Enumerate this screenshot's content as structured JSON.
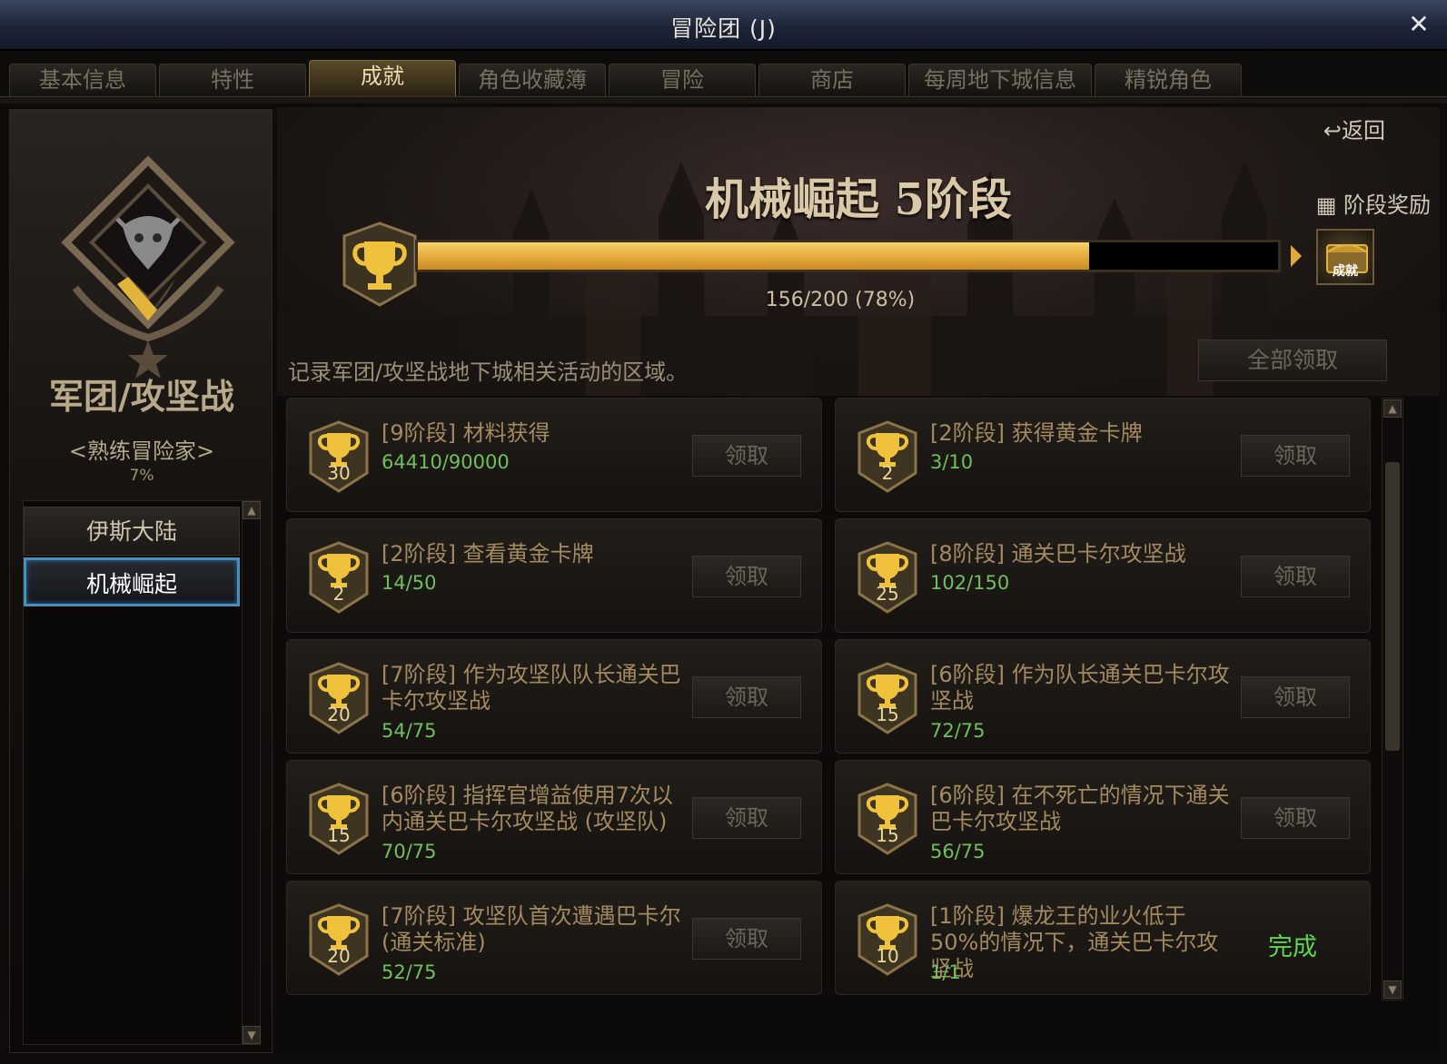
{
  "window": {
    "title": "冒险团 (J)",
    "close_icon": "✕"
  },
  "tabs": [
    {
      "label": "基本信息",
      "active": false
    },
    {
      "label": "特性",
      "active": false
    },
    {
      "label": "成就",
      "active": true
    },
    {
      "label": "角色收藏簿",
      "active": false
    },
    {
      "label": "冒险",
      "active": false
    },
    {
      "label": "商店",
      "active": false
    },
    {
      "label": "每周地下城信息",
      "active": false
    },
    {
      "label": "精锐角色",
      "active": false
    }
  ],
  "sidebar": {
    "title": "军团/攻坚战",
    "rank": "<熟练冒险家>",
    "percent": "7%",
    "categories": [
      {
        "label": "伊斯大陆",
        "selected": false
      },
      {
        "label": "机械崛起",
        "selected": true
      }
    ]
  },
  "stage": {
    "back_label": "↩返回",
    "title": "机械崛起 5阶段",
    "reward_label": "阶段奖励",
    "chest_label": "成就",
    "progress_text": "156/200 (78%)",
    "progress_fraction": 0.78,
    "description": "记录军团/攻坚战地下城相关活动的区域。",
    "claim_all_label": "全部领取"
  },
  "achievements": [
    {
      "points": "30",
      "title": "[9阶段] 材料获得",
      "count": "64410/90000",
      "action": "领取",
      "completed": false
    },
    {
      "points": "2",
      "title": "[2阶段] 获得黄金卡牌",
      "count": "3/10",
      "action": "领取",
      "completed": false
    },
    {
      "points": "2",
      "title": "[2阶段] 查看黄金卡牌",
      "count": "14/50",
      "action": "领取",
      "completed": false
    },
    {
      "points": "25",
      "title": "[8阶段] 通关巴卡尔攻坚战",
      "count": "102/150",
      "action": "领取",
      "completed": false
    },
    {
      "points": "20",
      "title": "[7阶段] 作为攻坚队队长通关巴卡尔攻坚战",
      "count": "54/75",
      "action": "领取",
      "completed": false
    },
    {
      "points": "15",
      "title": "[6阶段] 作为队长通关巴卡尔攻坚战",
      "count": "72/75",
      "action": "领取",
      "completed": false
    },
    {
      "points": "15",
      "title": "[6阶段] 指挥官增益使用7次以内通关巴卡尔攻坚战 (攻坚队)",
      "count": "70/75",
      "action": "领取",
      "completed": false
    },
    {
      "points": "15",
      "title": "[6阶段] 在不死亡的情况下通关巴卡尔攻坚战",
      "count": "56/75",
      "action": "领取",
      "completed": false
    },
    {
      "points": "20",
      "title": "[7阶段] 攻坚队首次遭遇巴卡尔 (通关标准)",
      "count": "52/75",
      "action": "领取",
      "completed": false
    },
    {
      "points": "10",
      "title": "[1阶段] 爆龙王的业火低于50%的情况下，通关巴卡尔攻坚战",
      "count": "1/1",
      "action": "完成",
      "completed": true
    }
  ],
  "colors": {
    "accent_gold": "#e2a93b",
    "progress_green": "#6fc05c",
    "complete_green": "#5fd54f",
    "selected_blue": "#4a8ec0"
  }
}
